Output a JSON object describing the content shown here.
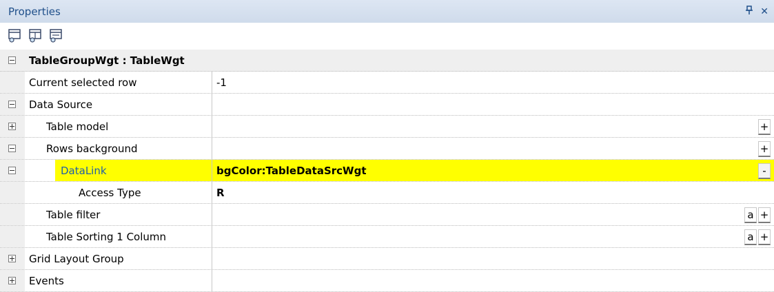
{
  "panel": {
    "title": "Properties",
    "pin_label": "ꟸ",
    "close_label": "✕"
  },
  "toolbar": {
    "icons": [
      "properties-view-icon",
      "add-property-icon",
      "edit-property-icon"
    ]
  },
  "grid": {
    "header": "TableGroupWgt : TableWgt",
    "rows": [
      {
        "name": "Current selected row",
        "value": "-1"
      },
      {
        "name": "Data Source",
        "value": ""
      },
      {
        "name": "Table model",
        "value": "",
        "btn": "+"
      },
      {
        "name": "Rows background",
        "value": "",
        "btn": "+"
      },
      {
        "name": "DataLink",
        "value": "bgColor:TableDataSrcWgt",
        "btn": "-"
      },
      {
        "name": "Access Type",
        "value": "R"
      },
      {
        "name": "Table filter",
        "value": "",
        "btn_a": "a",
        "btn": "+"
      },
      {
        "name": "Table Sorting 1 Column",
        "value": "",
        "btn_a": "a",
        "btn": "+"
      },
      {
        "name": "Grid Layout Group",
        "value": ""
      },
      {
        "name": "Events",
        "value": ""
      }
    ]
  },
  "colors": {
    "highlight": "#ffff00",
    "title_text": "#1f4f8a",
    "title_bg": "#d6e0ee"
  }
}
